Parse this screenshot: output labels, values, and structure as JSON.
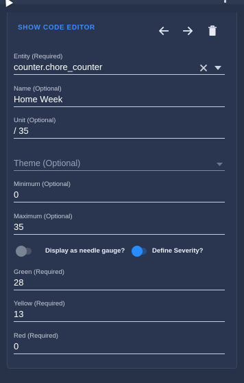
{
  "toolbar": {
    "show_code_label": "SHOW CODE EDITOR",
    "icons": [
      "arrow-left-icon",
      "arrow-right-icon",
      "delete-icon"
    ]
  },
  "entity": {
    "label": "Entity (Required)",
    "value": "counter.chore_counter"
  },
  "name": {
    "label": "Name (Optional)",
    "value": "Home Week"
  },
  "unit": {
    "label": "Unit (Optional)",
    "value": "/ 35"
  },
  "theme": {
    "placeholder": "Theme (Optional)"
  },
  "minimum": {
    "label": "Minimum (Optional)",
    "value": "0"
  },
  "maximum": {
    "label": "Maximum (Optional)",
    "value": "35"
  },
  "toggles": {
    "needle": {
      "label": "Display as needle gauge?",
      "checked": false
    },
    "severity": {
      "label": "Define Severity?",
      "checked": true
    }
  },
  "green": {
    "label": "Green (Required)",
    "value": "28"
  },
  "yellow": {
    "label": "Yellow (Required)",
    "value": "13"
  },
  "red": {
    "label": "Red (Required)",
    "value": "0"
  },
  "colors": {
    "accent": "#3c8cff",
    "background": "#273248",
    "toggle_off": "#6e7787"
  }
}
